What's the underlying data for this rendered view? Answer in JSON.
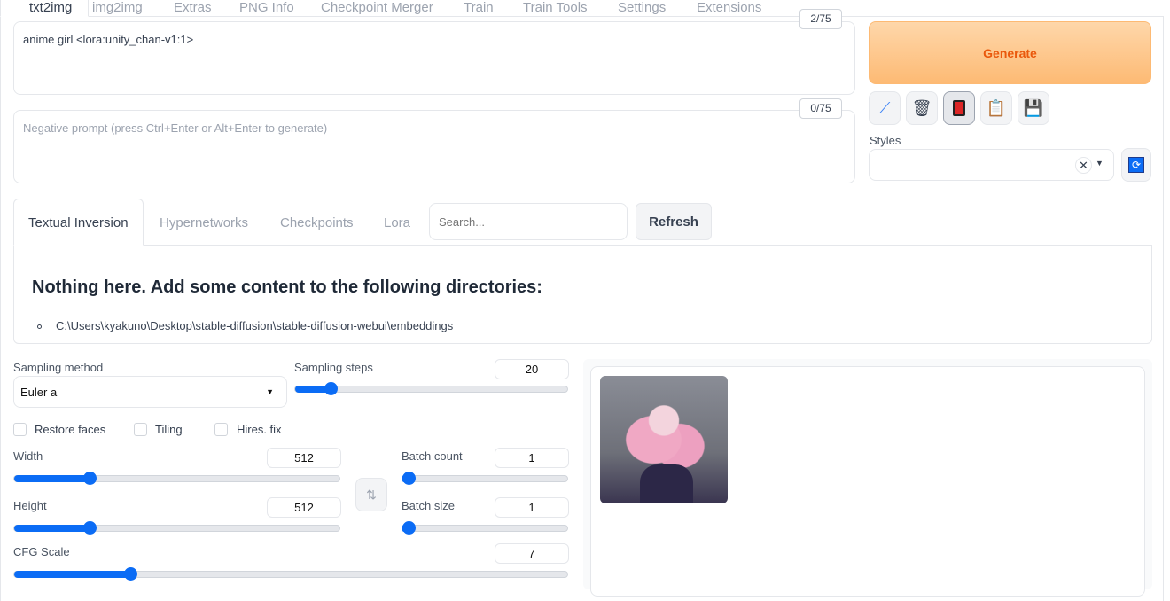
{
  "tabs": [
    "txt2img",
    "img2img",
    "Extras",
    "PNG Info",
    "Checkpoint Merger",
    "Train",
    "Train Tools",
    "Settings",
    "Extensions"
  ],
  "prompt": {
    "value": "anime girl <lora:unity_chan-v1:1>",
    "counter": "2/75"
  },
  "negative": {
    "placeholder": "Negative prompt (press Ctrl+Enter or Alt+Enter to generate)",
    "counter": "0/75"
  },
  "generate_label": "Generate",
  "tools": [
    "pencil-icon",
    "trash-icon",
    "red-card-icon",
    "clipboard-icon",
    "floppy-disk-icon"
  ],
  "styles": {
    "label": "Styles",
    "value": ""
  },
  "extra_networks": {
    "tabs": [
      "Textual Inversion",
      "Hypernetworks",
      "Checkpoints",
      "Lora"
    ],
    "search_placeholder": "Search...",
    "refresh_label": "Refresh",
    "heading": "Nothing here. Add some content to the following directories:",
    "dirs": [
      "C:\\Users\\kyakuno\\Desktop\\stable-diffusion\\stable-diffusion-webui\\embeddings"
    ]
  },
  "sampling_method": {
    "label": "Sampling method",
    "value": "Euler a"
  },
  "sampling_steps": {
    "label": "Sampling steps",
    "value": "20",
    "fill": 0.13
  },
  "checkboxes": [
    {
      "label": "Restore faces",
      "checked": false
    },
    {
      "label": "Tiling",
      "checked": false
    },
    {
      "label": "Hires. fix",
      "checked": false
    }
  ],
  "width": {
    "label": "Width",
    "value": "512",
    "fill": 0.23
  },
  "height": {
    "label": "Height",
    "value": "512",
    "fill": 0.23
  },
  "batch_count": {
    "label": "Batch count",
    "value": "1",
    "fill": 0
  },
  "batch_size": {
    "label": "Batch size",
    "value": "1",
    "fill": 0
  },
  "cfg_scale": {
    "label": "CFG Scale",
    "value": "7",
    "fill": 0.21
  },
  "colors": {
    "accent": "#0b6cf5",
    "generate": "#fdba74"
  }
}
